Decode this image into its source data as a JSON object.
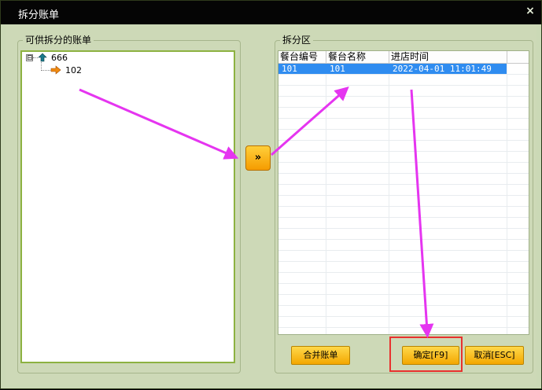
{
  "window": {
    "title": "拆分账单",
    "close_glyph": "×"
  },
  "left_group": {
    "title": "可供拆分的账单",
    "tree": [
      {
        "label": "666",
        "expander": "⊟",
        "icon": "up-arrow-icon"
      },
      {
        "label": "102",
        "icon": "right-arrow-icon"
      }
    ]
  },
  "move_button": {
    "label": "»"
  },
  "right_group": {
    "title": "拆分区",
    "columns": [
      "餐台编号",
      "餐台名称",
      "进店时间"
    ],
    "rows": [
      {
        "table_no": "101",
        "table_name": "101",
        "time": "2022-04-01 11:01:49"
      }
    ]
  },
  "buttons": {
    "merge": "合并账单",
    "confirm": "确定[F9]",
    "cancel": "取消[ESC]"
  },
  "colors": {
    "annotation_arrow": "#e535f0",
    "highlight": "#e8312e",
    "accent": "#f5a400"
  }
}
